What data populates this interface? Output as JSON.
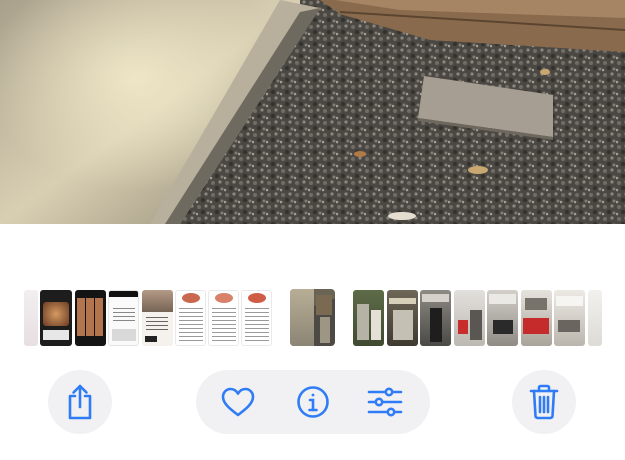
{
  "accent_color": "#2f7cf6",
  "photo": {
    "alt": ""
  },
  "thumbnails": {
    "selected_index": 9,
    "items": [
      {
        "kind": "photo-edge"
      },
      {
        "kind": "screenshot-food"
      },
      {
        "kind": "screenshot-grid"
      },
      {
        "kind": "screenshot-text"
      },
      {
        "kind": "screenshot-photo-text"
      },
      {
        "kind": "screenshot-document"
      },
      {
        "kind": "screenshot-document"
      },
      {
        "kind": "screenshot-document"
      },
      {
        "kind": "gap"
      },
      {
        "kind": "photo-gravel-house"
      },
      {
        "kind": "gap"
      },
      {
        "kind": "photo-interior"
      },
      {
        "kind": "photo-interior"
      },
      {
        "kind": "photo-interior"
      },
      {
        "kind": "photo-interior"
      },
      {
        "kind": "photo-interior"
      },
      {
        "kind": "photo-interior"
      },
      {
        "kind": "photo-interior"
      },
      {
        "kind": "photo-edge"
      }
    ]
  },
  "toolbar": {
    "share_icon": "share-icon",
    "favorite_icon": "heart-icon",
    "info_icon": "info-icon",
    "edit_icon": "sliders-icon",
    "delete_icon": "trash-icon"
  }
}
